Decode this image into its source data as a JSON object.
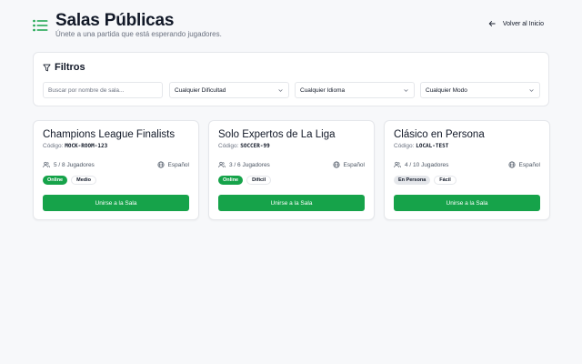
{
  "header": {
    "icon": "list-icon",
    "title": "Salas Públicas",
    "subtitle": "Únete a una partida que está esperando jugadores.",
    "back_label": "Volver al Inicio",
    "back_icon": "arrow-left-icon"
  },
  "filters": {
    "title": "Filtros",
    "icon": "filter-icon",
    "search_placeholder": "Buscar por nombre de sala...",
    "search_value": "",
    "difficulty": "Cualquier Dificultad",
    "language": "Cualquier Idioma",
    "mode": "Cualquier Modo"
  },
  "rooms": [
    {
      "name": "Champions League Finalists",
      "code_label": "Código:",
      "code": "MOCK-ROOM-123",
      "players": "5 / 8 Jugadores",
      "language": "Español",
      "mode": "Online",
      "difficulty": "Medio",
      "join_label": "Unirse a la Sala"
    },
    {
      "name": "Solo Expertos de La Liga",
      "code_label": "Código:",
      "code": "SOCCER-99",
      "players": "3 / 6 Jugadores",
      "language": "Español",
      "mode": "Online",
      "difficulty": "Difícil",
      "join_label": "Unirse a la Sala"
    },
    {
      "name": "Clásico en Persona",
      "code_label": "Código:",
      "code": "LOCAL-TEST",
      "players": "4 / 10 Jugadores",
      "language": "Español",
      "mode": "En Persona",
      "difficulty": "Fácil",
      "join_label": "Unirse a la Sala"
    }
  ],
  "colors": {
    "accent": "#16a34a",
    "background": "#f7f8fa",
    "card": "#ffffff",
    "border": "#e5e7eb",
    "muted_text": "#6b7280"
  }
}
